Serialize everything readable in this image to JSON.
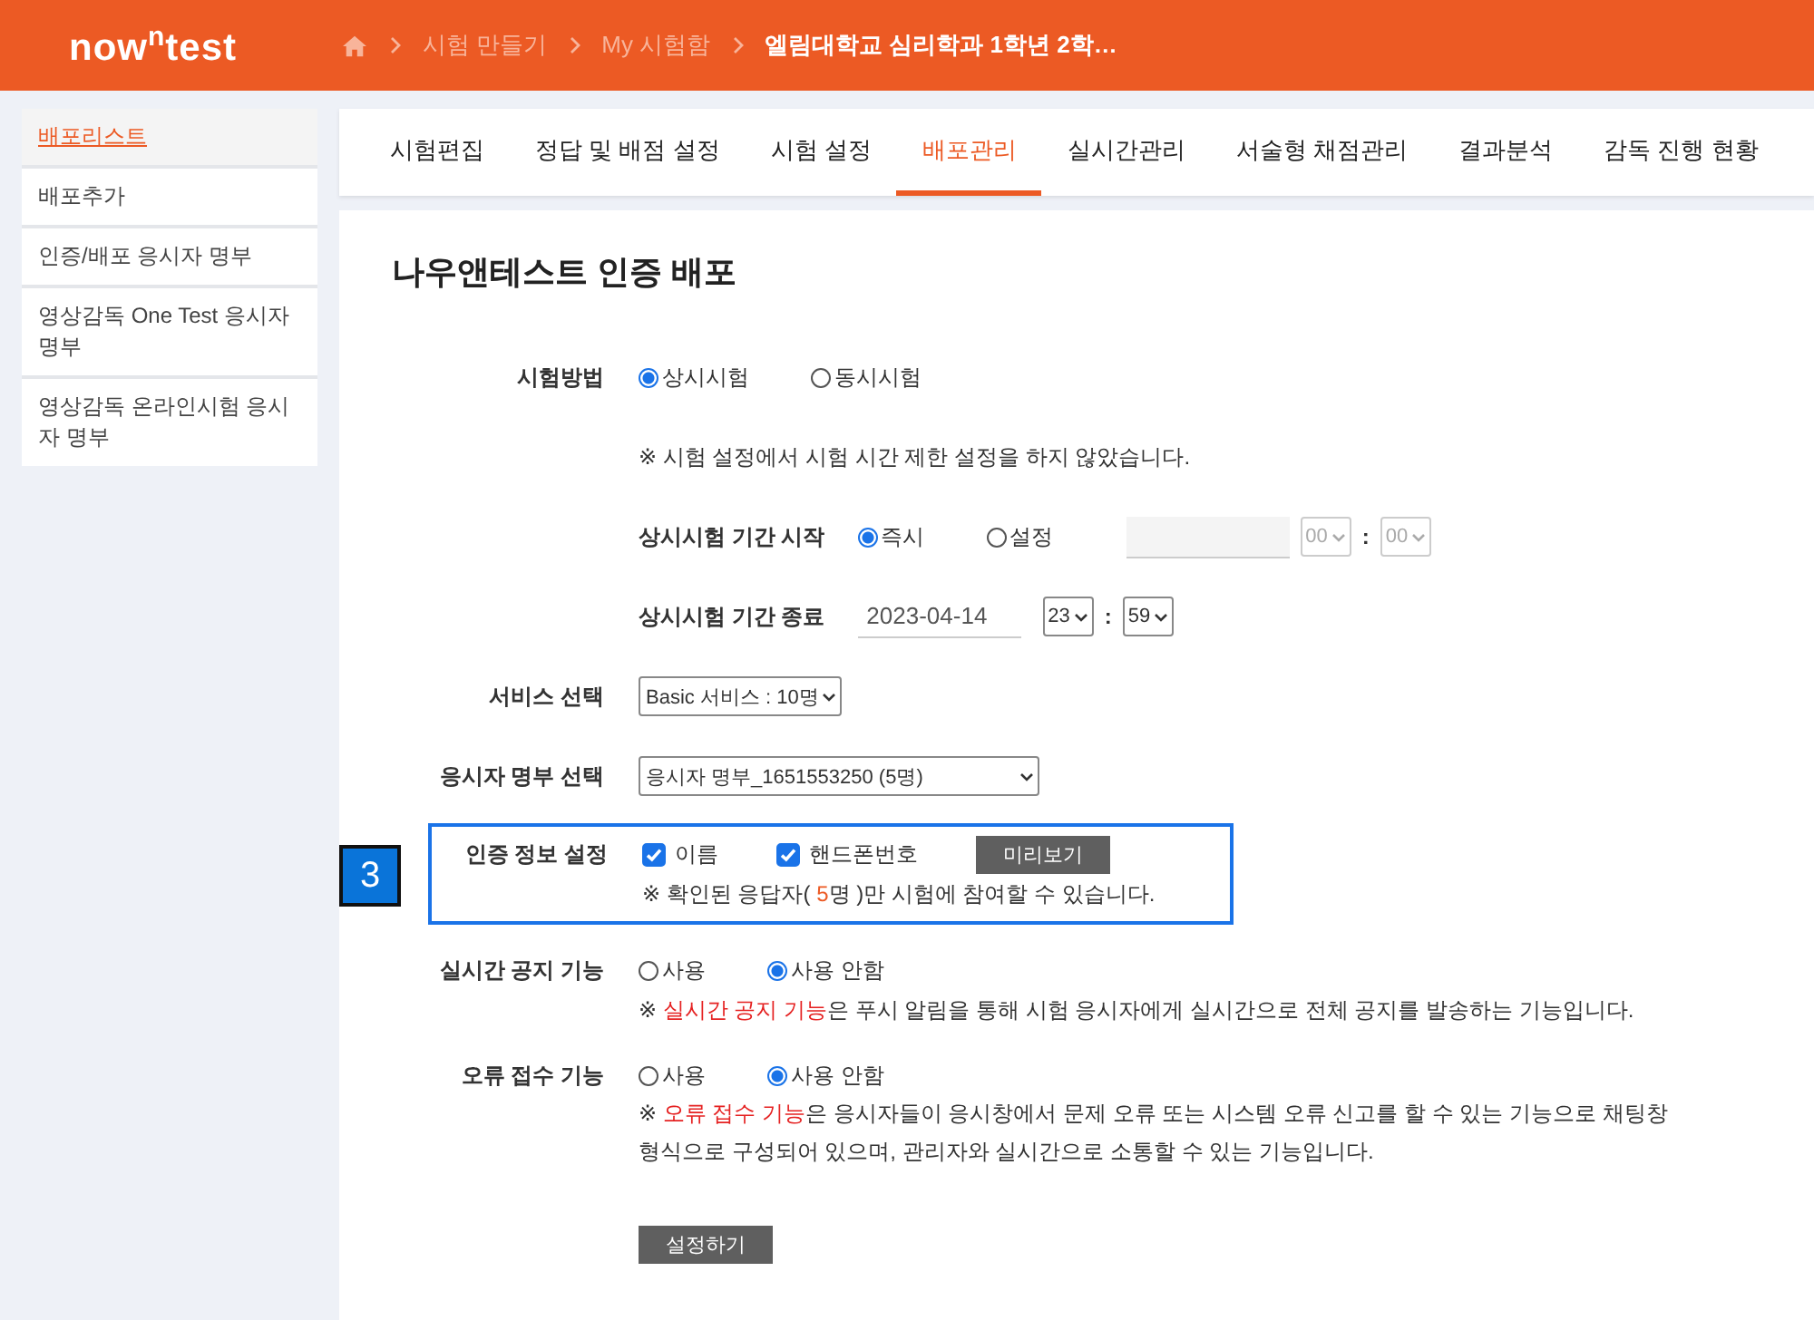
{
  "header": {
    "logo": "now$^{n}$test",
    "breadcrumbs": [
      {
        "label": "시험 만들기",
        "current": false
      },
      {
        "label": "My 시험함",
        "current": false
      },
      {
        "label": "엘림대학교 심리학과 1학년 2학…",
        "current": true
      }
    ]
  },
  "sidebar": {
    "items": [
      {
        "label": "배포리스트",
        "selected": true
      },
      {
        "label": "배포추가",
        "selected": false
      },
      {
        "label": "인증/배포 응시자 명부",
        "selected": false
      },
      {
        "label": "영상감독 One Test 응시자 명부",
        "selected": false
      },
      {
        "label": "영상감독 온라인시험 응시자 명부",
        "selected": false
      }
    ]
  },
  "tabs": [
    {
      "label": "시험편집",
      "selected": false
    },
    {
      "label": "정답 및 배점 설정",
      "selected": false
    },
    {
      "label": "시험 설정",
      "selected": false
    },
    {
      "label": "배포관리",
      "selected": true
    },
    {
      "label": "실시간관리",
      "selected": false
    },
    {
      "label": "서술형 채점관리",
      "selected": false
    },
    {
      "label": "결과분석",
      "selected": false
    },
    {
      "label": "감독 진행 현황",
      "selected": false
    }
  ],
  "title": "나우앤테스트 인증 배포",
  "method": {
    "label": "시험방법",
    "options": [
      {
        "label": "상시시험",
        "selected": true
      },
      {
        "label": "동시시험",
        "selected": false
      }
    ],
    "note": "※ 시험 설정에서 시험 시간 제한 설정을 하지 않았습니다."
  },
  "start": {
    "label": "상시시험 기간 시작",
    "options": [
      {
        "label": "즉시",
        "selected": true
      },
      {
        "label": "설정",
        "selected": false
      }
    ],
    "disabled": true,
    "hour": "00",
    "separator": ":",
    "minute": "00"
  },
  "end": {
    "label": "상시시험 기간 종료",
    "date": "2023-04-14",
    "hour": "23",
    "separator": ":",
    "minute": "59"
  },
  "service": {
    "label": "서비스 선택",
    "value": "Basic 서비스 : 10명"
  },
  "roster": {
    "label": "응시자 명부 선택",
    "value": "응시자 명부_1651553250 (5명)"
  },
  "auth": {
    "badge": "3",
    "label": "인증 정보 설정",
    "options": [
      {
        "label": "이름",
        "checked": true
      },
      {
        "label": "핸드폰번호",
        "checked": true
      }
    ],
    "preview_button": "미리보기",
    "note": [
      {
        "text": "※ 확인된 응답자( ",
        "accent": false
      },
      {
        "text": "5",
        "accent": true
      },
      {
        "text": "명 )만 시험에 참여할 수 있습니다.",
        "accent": false
      }
    ]
  },
  "realtime": {
    "label": "실시간 공지 기능",
    "options": [
      {
        "label": "사용",
        "selected": false
      },
      {
        "label": "사용 안함",
        "selected": true
      }
    ],
    "note": [
      {
        "text": "※ ",
        "accent": false
      },
      {
        "text": "실시간 공지 기능",
        "accent": true
      },
      {
        "text": "은 푸시 알림을 통해 시험 응시자에게 실시간으로 전체 공지를 발송하는 기능입니다.",
        "accent": false
      }
    ]
  },
  "error": {
    "label": "오류 접수 기능",
    "options": [
      {
        "label": "사용",
        "selected": false
      },
      {
        "label": "사용 안함",
        "selected": true
      }
    ],
    "note": [
      {
        "text": "※ ",
        "accent": false
      },
      {
        "text": "오류 접수 기능",
        "accent": true
      },
      {
        "text": "은 응시자들이 응시창에서 문제 오류 또는 시스템 오류 신고를 할 수 있는 기능으로 채팅창 형식으로 구성되어 있으며, 관리자와 실시간으로 소통할 수 있는 기능입니다.",
        "accent": false
      }
    ]
  },
  "submit": "설정하기"
}
